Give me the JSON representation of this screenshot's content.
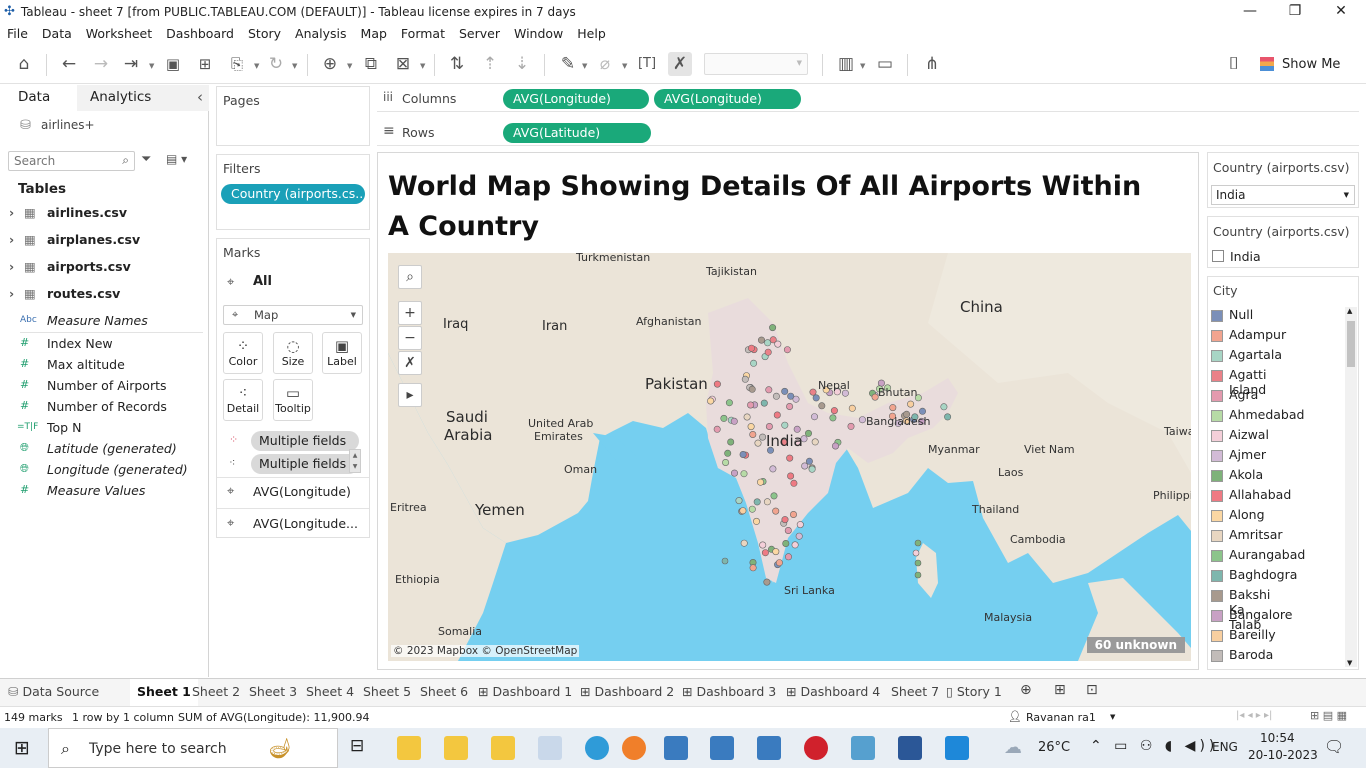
{
  "window": {
    "title": "Tableau - sheet 7 [from PUBLIC.TABLEAU.COM (DEFAULT)] - Tableau license expires in 7 days"
  },
  "menu": [
    "File",
    "Data",
    "Worksheet",
    "Dashboard",
    "Story",
    "Analysis",
    "Map",
    "Format",
    "Server",
    "Window",
    "Help"
  ],
  "toolbar": {
    "show_me": "Show Me"
  },
  "data_pane": {
    "tab_data": "Data",
    "tab_analytics": "Analytics",
    "datasource": "airlines+",
    "search_placeholder": "Search",
    "tables_header": "Tables",
    "tables": [
      "airlines.csv",
      "airplanes.csv",
      "airports.csv",
      "routes.csv"
    ],
    "fields": [
      {
        "icon": "Abc",
        "name": "Measure Names",
        "italic": true
      },
      {
        "icon": "#",
        "name": "Index New",
        "italic": false
      },
      {
        "icon": "#",
        "name": "Max altitude",
        "italic": false
      },
      {
        "icon": "#",
        "name": "Number of Airports",
        "italic": false
      },
      {
        "icon": "#",
        "name": "Number of Records",
        "italic": false
      },
      {
        "icon": "=T|F",
        "name": "Top N",
        "italic": false
      },
      {
        "icon": "globe",
        "name": "Latitude (generated)",
        "italic": true
      },
      {
        "icon": "globe",
        "name": "Longitude (generated)",
        "italic": true
      },
      {
        "icon": "#",
        "name": "Measure Values",
        "italic": true
      }
    ]
  },
  "shelves": {
    "pages": "Pages",
    "filters": "Filters",
    "filter_pill": "Country (airports.cs..",
    "marks": "Marks",
    "marks_all": "All",
    "mark_type": "Map",
    "cards": [
      "Color",
      "Size",
      "Label",
      "Detail",
      "Tooltip"
    ],
    "multi1": "Multiple fields",
    "multi2": "Multiple fields",
    "layer1": "AVG(Longitude)",
    "layer2": "AVG(Longitude...",
    "columns_label": "Columns",
    "columns": [
      "AVG(Longitude)",
      "AVG(Longitude)"
    ],
    "rows_label": "Rows",
    "rows": [
      "AVG(Latitude)"
    ]
  },
  "viz": {
    "title": "World Map Showing Details Of All Airports Within A Country",
    "attribution": "© 2023 Mapbox © OpenStreetMap",
    "unknown": "60 unknown",
    "labels": [
      "Turkmenistan",
      "Tajikistan",
      "Iraq",
      "Iran",
      "Afghanistan",
      "China",
      "Pakistan",
      "Nepal",
      "Bhutan",
      "Saudi",
      "Arabia",
      "United Arab",
      "Emirates",
      "India",
      "Bangladesh",
      "Myanmar",
      "Taiwa",
      "Oman",
      "Viet Nam",
      "Laos",
      "Yemen",
      "Eritrea",
      "Thailand",
      "Philippi",
      "Cambodia",
      "Ethiopia",
      "Sri Lanka",
      "Malaysia",
      "Somalia"
    ]
  },
  "right_panel": {
    "filter1_title": "Country (airports.csv)",
    "filter1_value": "India",
    "filter2_title": "Country (airports.csv)",
    "filter2_item": "India",
    "city_title": "City",
    "cities": [
      {
        "name": "Null",
        "color": "#7b8fb8"
      },
      {
        "name": "Adampur",
        "color": "#f1a48f"
      },
      {
        "name": "Agartala",
        "color": "#a8d5c5"
      },
      {
        "name": "Agatti Island",
        "color": "#ea8188"
      },
      {
        "name": "Agra",
        "color": "#e39aae"
      },
      {
        "name": "Ahmedabad",
        "color": "#b7dba6"
      },
      {
        "name": "Aizwal",
        "color": "#f4cfd9"
      },
      {
        "name": "Ajmer",
        "color": "#d2bbd6"
      },
      {
        "name": "Akola",
        "color": "#7fb27a"
      },
      {
        "name": "Allahabad",
        "color": "#ee7a83"
      },
      {
        "name": "Along",
        "color": "#fbd7a3"
      },
      {
        "name": "Amritsar",
        "color": "#e8d6c1"
      },
      {
        "name": "Aurangabad",
        "color": "#8cc48b"
      },
      {
        "name": "Baghdogra",
        "color": "#7eb6ad"
      },
      {
        "name": "Bakshi Ka Talab",
        "color": "#a89a8e"
      },
      {
        "name": "Bangalore",
        "color": "#c8a1c4"
      },
      {
        "name": "Bareilly",
        "color": "#f8cfa0"
      },
      {
        "name": "Baroda",
        "color": "#c2bcb9"
      }
    ]
  },
  "sheet_tabs": [
    "Data Source",
    "Sheet 1",
    "Sheet 2",
    "Sheet 3",
    "Sheet 4",
    "Sheet 5",
    "Sheet 6",
    "Dashboard 1",
    "Dashboard 2",
    "Dashboard 3",
    "Dashboard 4",
    "Sheet 7",
    "Story 1"
  ],
  "status": {
    "marks": "149 marks",
    "dims": "1 row by 1 column",
    "sum": "SUM of AVG(Longitude): 11,900.94",
    "user": "Ravanan ra1"
  },
  "taskbar": {
    "search_placeholder": "Type here to search",
    "weather": "26°C",
    "lang": "ENG",
    "time": "10:54",
    "date": "20-10-2023"
  }
}
